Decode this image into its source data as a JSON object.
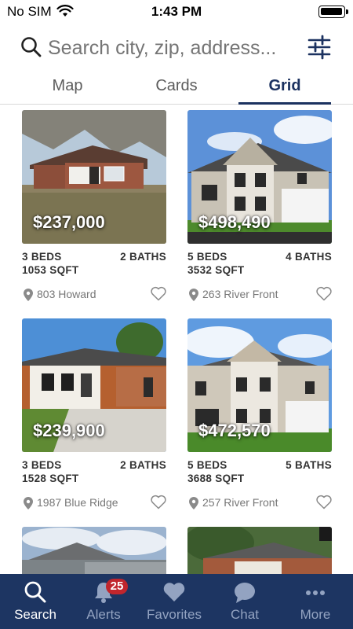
{
  "status_bar": {
    "carrier": "No SIM",
    "time": "1:43 PM"
  },
  "search": {
    "placeholder": "Search city, zip, address..."
  },
  "view_tabs": [
    {
      "label": "Map",
      "active": false
    },
    {
      "label": "Cards",
      "active": false
    },
    {
      "label": "Grid",
      "active": true
    }
  ],
  "listings": [
    {
      "price": "$237,000",
      "beds": "3 BEDS",
      "baths": "2 BATHS",
      "sqft": "1053 SQFT",
      "address": "803 Howard",
      "favorited": false
    },
    {
      "price": "$498,490",
      "beds": "5 BEDS",
      "baths": "4 BATHS",
      "sqft": "3532 SQFT",
      "address": "263 River Front",
      "favorited": false
    },
    {
      "price": "$239,900",
      "beds": "3 BEDS",
      "baths": "2 BATHS",
      "sqft": "1528 SQFT",
      "address": "1987 Blue Ridge",
      "favorited": false
    },
    {
      "price": "$472,570",
      "beds": "5 BEDS",
      "baths": "5 BATHS",
      "sqft": "3688 SQFT",
      "address": "257 River Front",
      "favorited": false
    }
  ],
  "tabbar": {
    "items": [
      {
        "label": "Search",
        "icon": "search-icon",
        "active": true
      },
      {
        "label": "Alerts",
        "icon": "bell-icon",
        "active": false,
        "badge": "25"
      },
      {
        "label": "Favorites",
        "icon": "heart-icon",
        "active": false
      },
      {
        "label": "Chat",
        "icon": "chat-bubble-icon",
        "active": false
      },
      {
        "label": "More",
        "icon": "more-dots-icon",
        "active": false
      }
    ]
  },
  "colors": {
    "brand_navy": "#1d3562",
    "active_tab": "#1c3260",
    "badge_red": "#c1262d"
  }
}
